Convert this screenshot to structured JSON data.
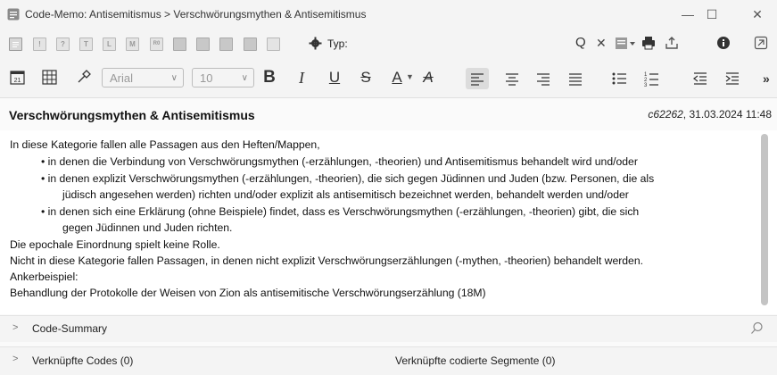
{
  "window": {
    "title": "Code-Memo: Antisemitismus > Verschwörungsmythen & Antisemitismus",
    "controls": {
      "minimize": "—",
      "maximize": "☐",
      "close": "✕"
    }
  },
  "toolbar": {
    "code_type_buttons": [
      "",
      "!",
      "?",
      "T",
      "L",
      "M",
      "R0",
      "",
      "",
      "",
      "",
      ""
    ],
    "type_label": "Typ:",
    "search_glyph": "Q",
    "clear_glyph": "✕"
  },
  "format_toolbar": {
    "font_family": "Arial",
    "font_size": "10",
    "bold": "B",
    "italic": "I",
    "underline": "U",
    "strike": "S",
    "font_color": "A",
    "clear_format": "A",
    "more": "»"
  },
  "memo": {
    "title": "Verschwörungsmythen & Antisemitismus",
    "author": "c62262",
    "date": ", 31.03.2024 11:48",
    "lines": [
      "In diese Kategorie fallen alle Passagen aus den Heften/Mappen,",
      "•  in denen die Verbindung von Verschwörungsmythen (-erzählungen, -theorien) und  Antisemitismus behandelt wird und/oder",
      "•  in denen explizit Verschwörungsmythen (-erzählungen, -theorien), die sich gegen Jüdinnen und Juden (bzw. Personen, die als",
      "jüdisch angesehen werden) richten und/oder explizit als antisemitisch bezeichnet werden, behandelt werden und/oder",
      "•  in denen sich eine Erklärung (ohne Beispiele) findet, dass es Verschwörungsmythen (-erzählungen, -theorien) gibt, die sich",
      "gegen Jüdinnen und Juden richten.",
      "Die epochale Einordnung spielt keine Rolle.",
      "Nicht in diese Kategorie fallen Passagen, in denen nicht explizit Verschwörungserzählungen (-mythen, -theorien) behandelt werden.",
      "Ankerbeispiel:",
      "Behandlung der Protokolle der Weisen von Zion als antisemitische Verschwörungserzählung (18M)"
    ]
  },
  "panels": {
    "chevron": ">",
    "summary_label": "Code-Summary",
    "linked_codes": "Verknüpfte Codes (0)",
    "linked_segments": "Verknüpfte codierte Segmente (0)"
  }
}
